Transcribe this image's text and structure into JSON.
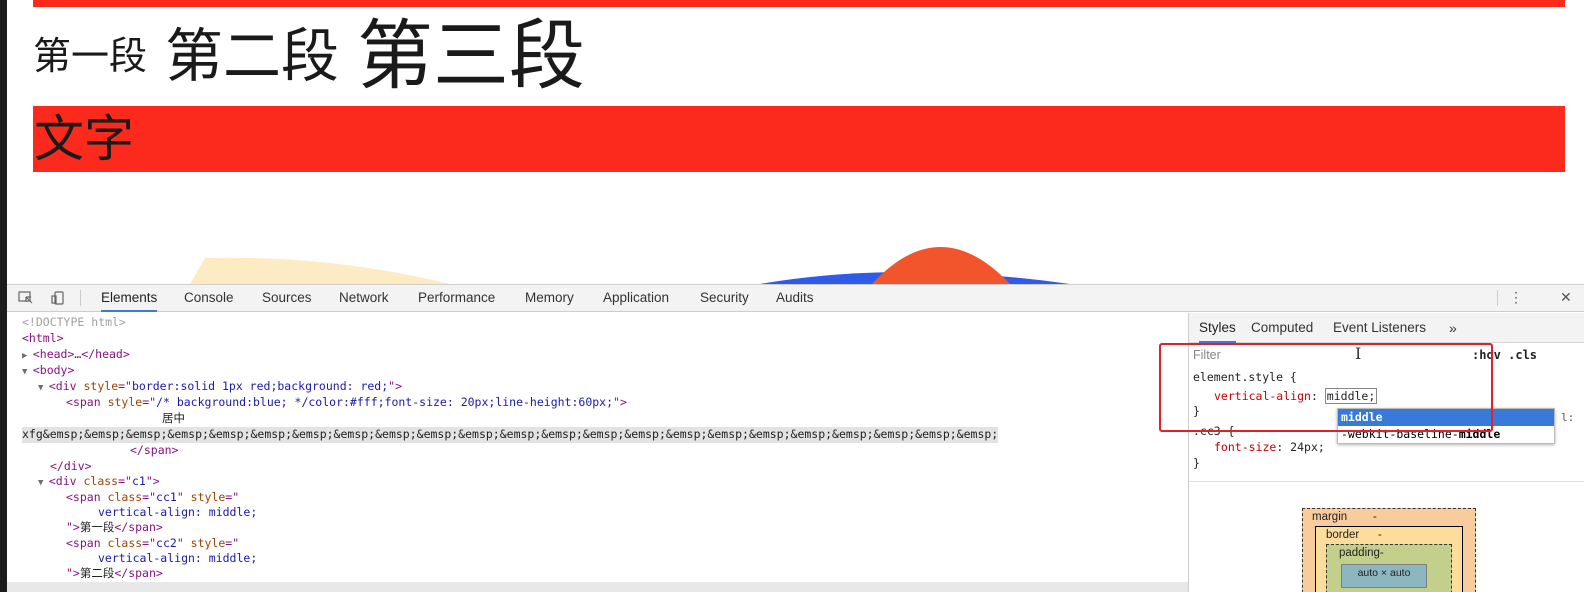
{
  "page": {
    "seg1": "第一段",
    "seg2": "第二段",
    "seg3": "第三段",
    "red_text": "文字"
  },
  "devtools": {
    "tabs": [
      "Elements",
      "Console",
      "Sources",
      "Network",
      "Performance",
      "Memory",
      "Application",
      "Security",
      "Audits"
    ],
    "active_tab": "Elements",
    "icons": {
      "inspect": "inspect-element-icon",
      "device": "device-toolbar-icon",
      "menu": "kebab-menu-icon",
      "close": "close-icon"
    },
    "elements": {
      "doctype": "<!DOCTYPE html>",
      "html_open": "<html>",
      "head": "<head>…</head>",
      "body": "<body>",
      "div1_tag": "div",
      "div1_attr": "style",
      "div1_val": "border:solid 1px red;background: red;",
      "span1_tag": "span",
      "span1_attr": "style",
      "span1_val": "/* background:blue; */color:#fff;font-size: 20px;line-height:60px;",
      "span1_text1": "居中",
      "span1_text2": "xfg&emsp;&emsp;&emsp;&emsp;&emsp;&emsp;&emsp;&emsp;&emsp;&emsp;&emsp;&emsp;&emsp;&emsp;&emsp;&emsp;&emsp;&emsp;&emsp;&emsp;&emsp;&emsp;&emsp;",
      "span1_close": "</span>",
      "div1_close": "</div>",
      "div2_attr": "class",
      "div2_val": "c1",
      "cc1_class": "cc1",
      "style_attr": "style",
      "valign_decl": "vertical-align: middle;",
      "cc1_text": "第一段",
      "cc2_class": "cc2",
      "cc2_text": "第二段",
      "cc3_class": "cc3"
    },
    "styles": {
      "tabs": [
        "Styles",
        "Computed",
        "Event Listeners"
      ],
      "more": "»",
      "filter_placeholder": "Filter",
      "hov_cls": ":hov  .cls",
      "element_style_selector": "element.style {",
      "property": "vertical-align",
      "value": "middle",
      "close_brace": "}",
      "autocomplete": [
        "middle",
        "-webkit-baseline-middle"
      ],
      "ac_right": "l:",
      "cc3_selector": ".cc3 {",
      "cc3_prop": "font-size",
      "cc3_value": "24px;",
      "box_model": {
        "margin": "margin",
        "margin_val": "-",
        "border": "border",
        "border_val": "-",
        "padding": "padding-",
        "content": "auto × auto"
      }
    }
  },
  "colors": {
    "red": "#fb2a1d",
    "accent": "#3879d9"
  }
}
